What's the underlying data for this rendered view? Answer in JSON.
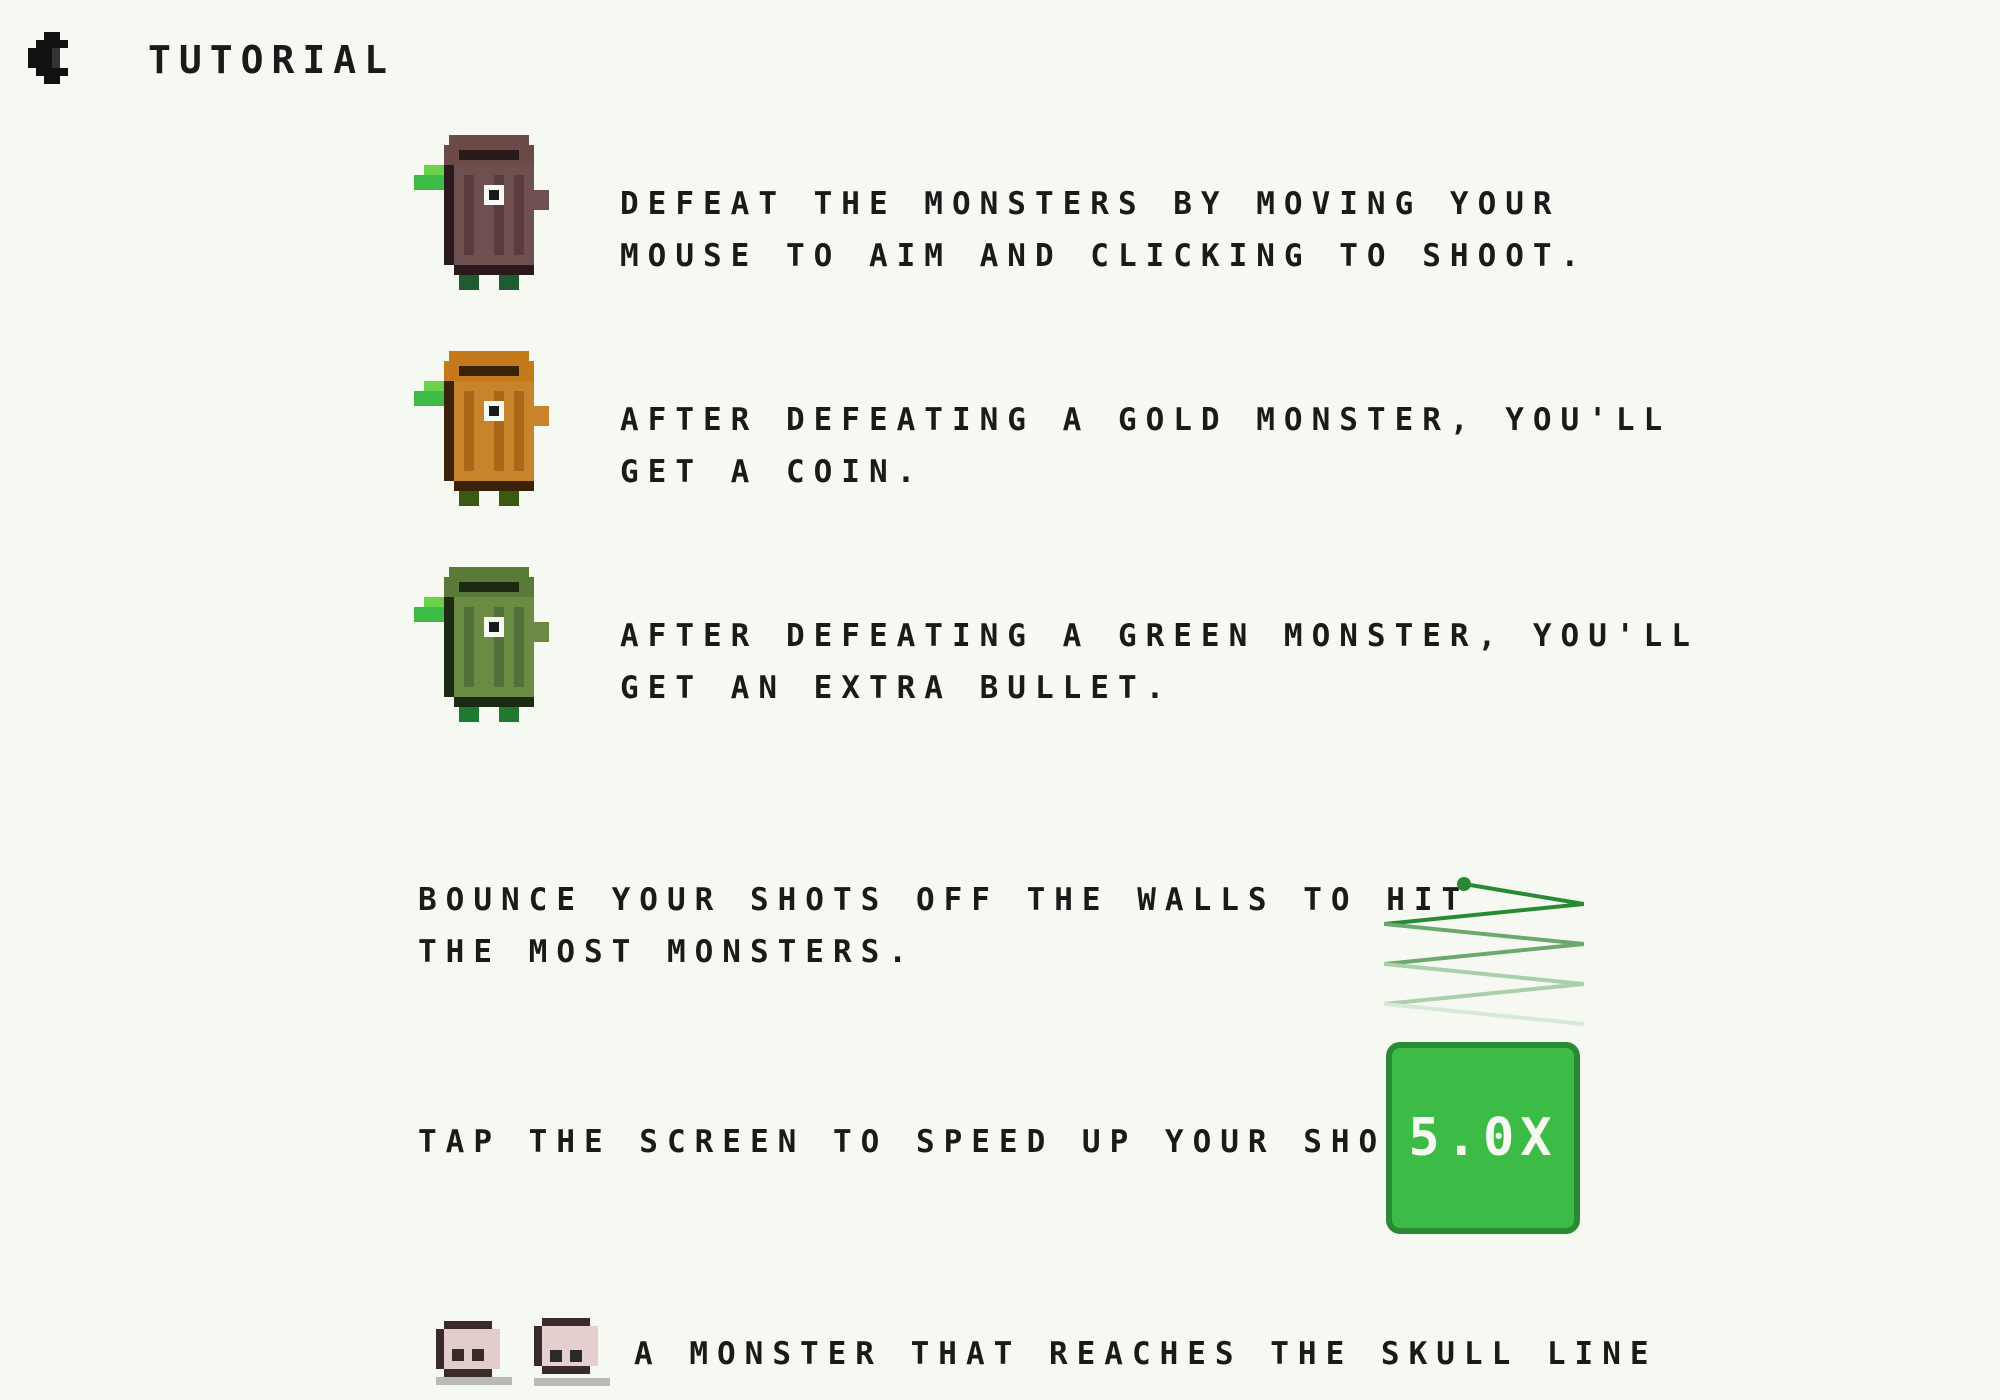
{
  "header": {
    "title": "TUTORIAL"
  },
  "rows": [
    {
      "text_line1": "DEFEAT THE MONSTERS BY MOVING YOUR",
      "text_line2": "MOUSE TO AIM AND CLICKING TO SHOOT.",
      "monster": "brown"
    },
    {
      "text_line1": "AFTER DEFEATING A GOLD MONSTER, YOU'LL",
      "text_line2": "GET A COIN.",
      "monster": "gold"
    },
    {
      "text_line1": "AFTER DEFEATING A GREEN MONSTER, YOU'LL",
      "text_line2": "GET AN EXTRA BULLET.",
      "monster": "green"
    }
  ],
  "bounce": {
    "text_line1": "BOUNCE YOUR SHOTS OFF THE WALLS TO HIT",
    "text_line2": "THE MOST MONSTERS."
  },
  "speed": {
    "text": "TAP THE SCREEN TO SPEED UP YOUR SHOTS.",
    "button_label": "5.0X"
  },
  "skull": {
    "text": "A MONSTER THAT REACHES THE SKULL LINE"
  },
  "colors": {
    "background": "#f6f9f1",
    "accent_green": "#3dbb47",
    "accent_green_dark": "#2a8a33",
    "text": "#1a1a1a"
  },
  "icons": {
    "back": "back-arrow-icon"
  }
}
